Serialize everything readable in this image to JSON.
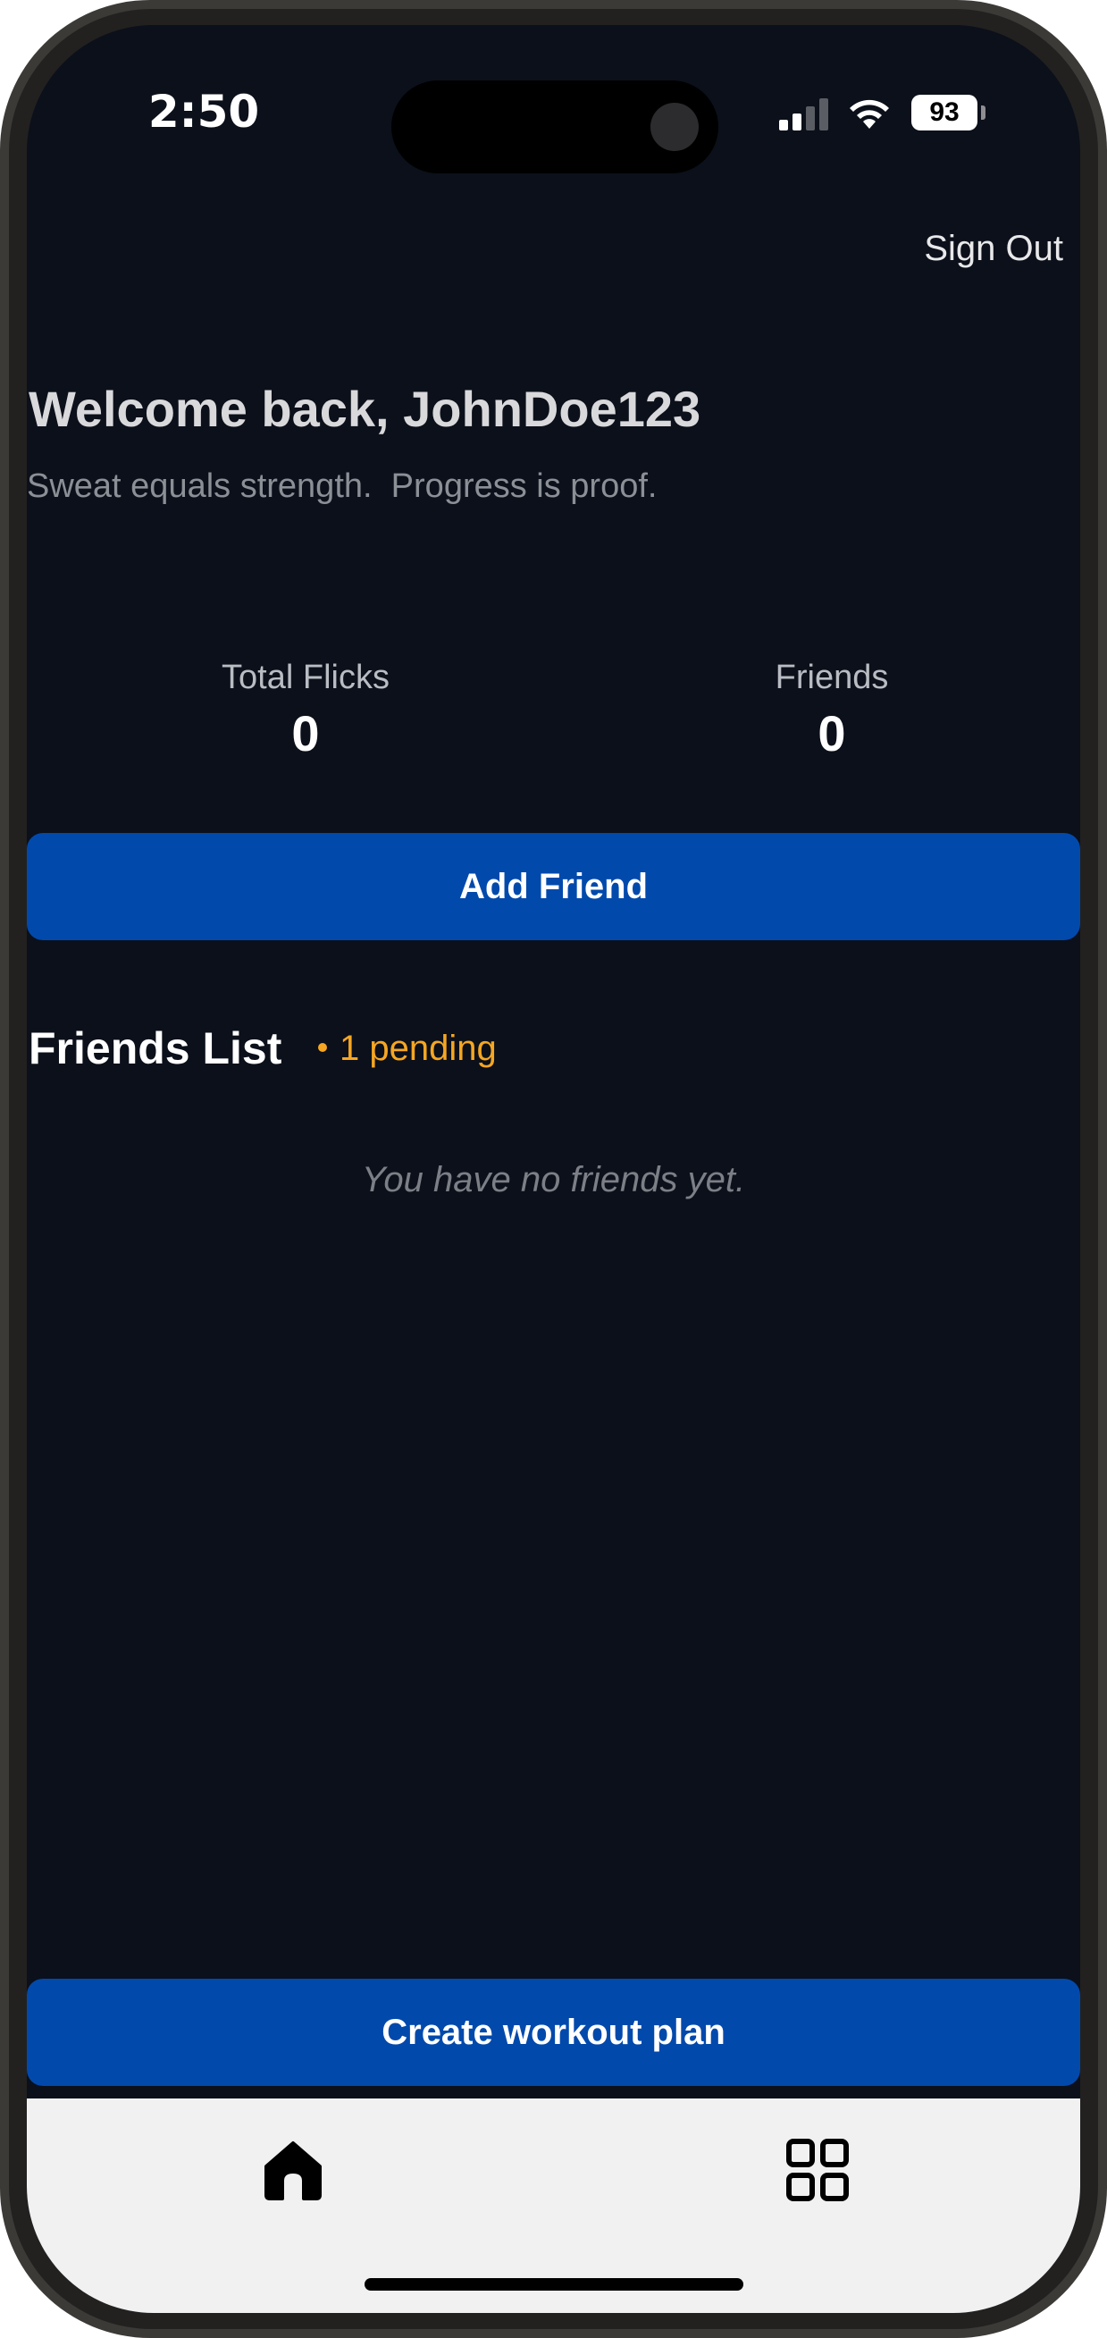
{
  "status_bar": {
    "time": "2:50",
    "battery": "93",
    "signal_icon": "cellular-signal-icon",
    "wifi_icon": "wifi-icon"
  },
  "header": {
    "sign_out": "Sign Out",
    "welcome": "Welcome back, JohnDoe123",
    "tagline": "Sweat equals strength.  Progress is proof."
  },
  "stats": {
    "total_flicks_label": "Total Flicks",
    "total_flicks_value": "0",
    "friends_label": "Friends",
    "friends_value": "0"
  },
  "buttons": {
    "add_friend": "Add Friend",
    "create_workout_plan": "Create workout plan"
  },
  "friends": {
    "title": "Friends List",
    "pending": "1 pending",
    "empty_message": "You have no friends yet."
  },
  "tab_bar": {
    "items": [
      {
        "icon": "home-icon"
      },
      {
        "icon": "grid-icon"
      }
    ]
  },
  "colors": {
    "background": "#0b101a",
    "primary_button": "#0249ac",
    "pending_accent": "#f5a623",
    "tab_bar": "#f1f1f2"
  }
}
